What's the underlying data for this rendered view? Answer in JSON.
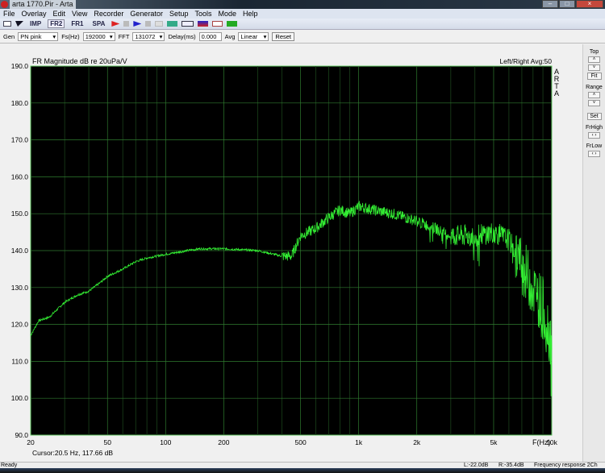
{
  "window": {
    "title": "arta 1770.Pir - Arta"
  },
  "menu": [
    "File",
    "Overlay",
    "Edit",
    "View",
    "Recorder",
    "Generator",
    "Setup",
    "Tools",
    "Mode",
    "Help"
  ],
  "toolbar": {
    "imp": "IMP",
    "fr2": "FR2",
    "fr1": "FR1",
    "spa": "SPA"
  },
  "gen": {
    "gen_label": "Gen",
    "gen_value": "PN pink",
    "fs_label": "Fs(Hz)",
    "fs_value": "192000",
    "fft_label": "FFT",
    "fft_value": "131072",
    "delay_label": "Delay(ms)",
    "delay_value": "0.000",
    "avg_label": "Avg",
    "avg_value": "Linear",
    "reset": "Reset"
  },
  "right_panel": {
    "top": "Top",
    "fit": "Fit",
    "range": "Range",
    "set": "Set",
    "frhigh": "FrHigh",
    "frlow": "FrLow"
  },
  "status": {
    "ready": "Ready",
    "left": "L:-22.0dB",
    "right": "R:-35.4dB",
    "mode": "Frequency response 2Ch"
  },
  "chart_data": {
    "type": "line",
    "title": "FR Magnitude dB re 20uPa/V",
    "info": "Left/Right  Avg:50",
    "logo": "ARTA",
    "xlabel": "F(Hz)",
    "ylabel": "",
    "cursor": "Cursor:20.5 Hz, 117.66 dB",
    "xscale": "log",
    "xlim": [
      20,
      10000
    ],
    "ylim": [
      90,
      190
    ],
    "xticks": [
      20,
      50,
      100,
      200,
      500,
      1000,
      2000,
      5000,
      10000
    ],
    "xtick_labels": [
      "20",
      "50",
      "100",
      "200",
      "500",
      "1k",
      "2k",
      "5k",
      "10k"
    ],
    "yticks": [
      "190.0",
      "180.0",
      "170.0",
      "160.0",
      "150.0",
      "140.0",
      "130.0",
      "120.0",
      "110.0",
      "100.0",
      "90.0"
    ],
    "grid": true,
    "line_color": "#33ee33",
    "series": [
      {
        "name": "FR",
        "x": [
          20,
          22,
          25,
          30,
          35,
          40,
          45,
          50,
          60,
          70,
          80,
          100,
          130,
          150,
          200,
          300,
          400,
          450,
          480,
          500,
          600,
          700,
          800,
          900,
          1000,
          1200,
          1500,
          2000,
          2500,
          3000,
          4000,
          5000,
          6000,
          7000,
          8000,
          9000,
          10000
        ],
        "y": [
          117,
          121,
          122,
          126,
          128,
          129,
          131,
          133,
          135,
          137,
          138,
          139,
          140,
          140.5,
          140.5,
          140,
          138.5,
          138.5,
          142,
          144,
          146,
          149,
          151,
          150,
          152,
          151,
          150,
          148,
          146,
          144,
          144,
          145,
          143,
          136,
          130,
          125,
          115
        ]
      }
    ]
  }
}
